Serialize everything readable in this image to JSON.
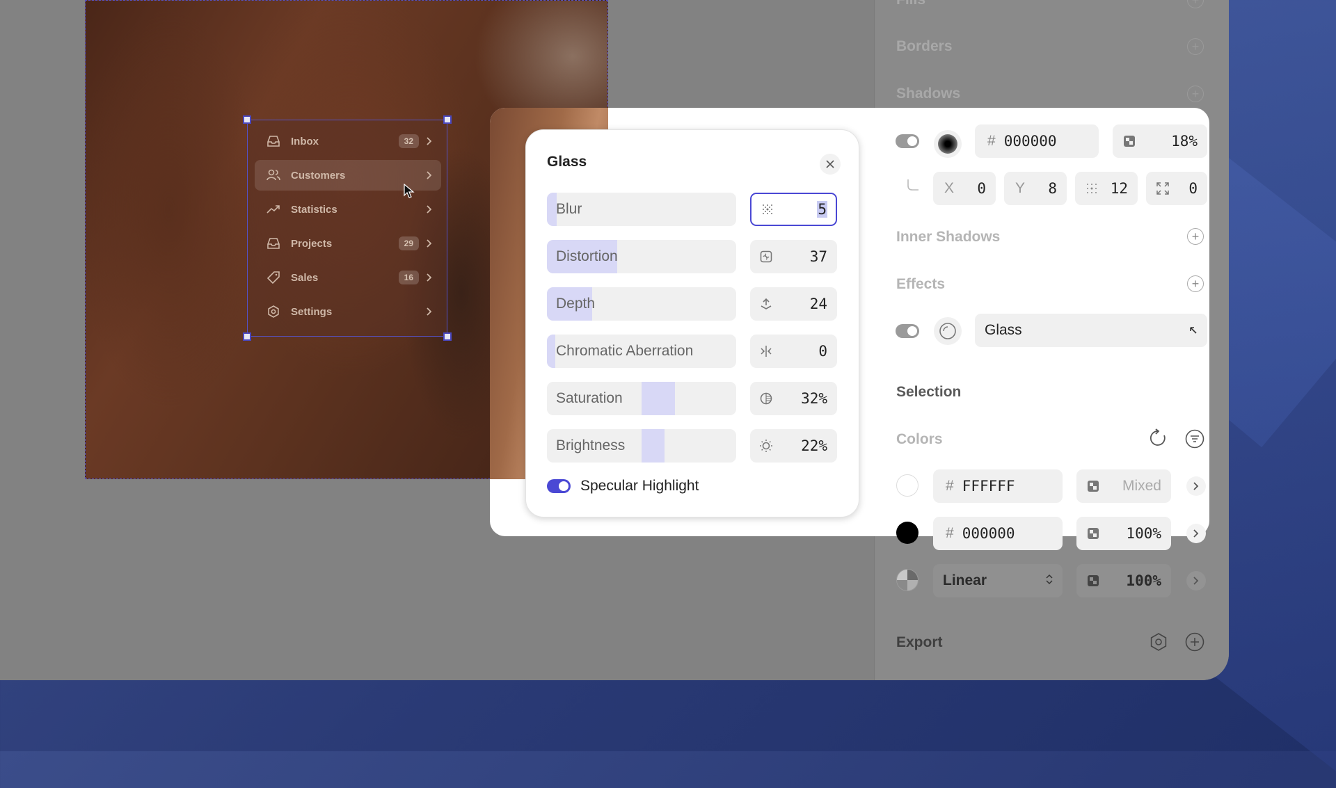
{
  "nav_menu": {
    "items": [
      {
        "label": "Inbox",
        "badge": "32",
        "icon": "inbox-icon"
      },
      {
        "label": "Customers",
        "badge": "",
        "icon": "users-icon"
      },
      {
        "label": "Statistics",
        "badge": "",
        "icon": "trend-icon"
      },
      {
        "label": "Projects",
        "badge": "29",
        "icon": "inbox-icon"
      },
      {
        "label": "Sales",
        "badge": "16",
        "icon": "tag-icon"
      },
      {
        "label": "Settings",
        "badge": "",
        "icon": "gear-icon"
      }
    ]
  },
  "glass_dialog": {
    "title": "Glass",
    "controls": [
      {
        "label": "Blur",
        "value": "5",
        "level": 0.05,
        "icon": "blur-icon",
        "focused": true
      },
      {
        "label": "Distortion",
        "value": "37",
        "level": 0.37,
        "icon": "distortion-icon"
      },
      {
        "label": "Depth",
        "value": "24",
        "level": 0.24,
        "icon": "depth-icon"
      },
      {
        "label": "Chromatic Aberration",
        "value": "0",
        "level": 0,
        "icon": "chromatic-icon"
      },
      {
        "label": "Saturation",
        "value": "32%",
        "level": 0.32,
        "icon": "saturation-icon"
      },
      {
        "label": "Brightness",
        "value": "22%",
        "level": 0.22,
        "icon": "brightness-icon"
      }
    ],
    "specular": {
      "label": "Specular Highlight",
      "enabled": true
    }
  },
  "properties": {
    "fills_title": "Fills",
    "borders_title": "Borders",
    "shadows_title": "Shadows",
    "shadow": {
      "hash": "#",
      "color": "000000",
      "opacity": "18%",
      "x_label": "X",
      "x": "0",
      "y_label": "Y",
      "y": "8",
      "blur": "12",
      "spread": "0"
    },
    "inner_shadows_title": "Inner Shadows",
    "effects_title": "Effects",
    "effect": {
      "name": "Glass"
    },
    "selection_title": "Selection",
    "colors_title": "Colors",
    "colors": [
      {
        "hash": "#",
        "value": "FFFFFF",
        "opacity": "Mixed",
        "swatch": "#ffffff"
      },
      {
        "hash": "#",
        "value": "000000",
        "opacity": "100%",
        "swatch": "#000000"
      },
      {
        "hash": "",
        "value": "Linear",
        "opacity": "100%",
        "swatch": "gradient"
      }
    ],
    "export_title": "Export"
  }
}
